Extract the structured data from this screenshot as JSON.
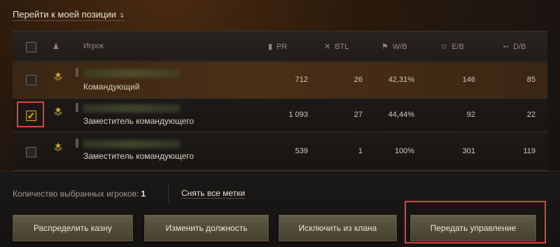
{
  "top": {
    "goto_label": "Перейти к моей позиции",
    "goto_arrow": "↴"
  },
  "table": {
    "headers": {
      "player": "Игрок",
      "pr": "PR",
      "btl": "BTL",
      "wb": "W/B",
      "eb": "E/B",
      "db": "D/B"
    },
    "rows": [
      {
        "role": "Командующий",
        "pr": "712",
        "btl": "26",
        "wb": "42,31%",
        "eb": "146",
        "db": "85",
        "checked": false
      },
      {
        "role": "Заместитель командующего",
        "pr": "1 093",
        "btl": "27",
        "wb": "44,44%",
        "eb": "92",
        "db": "22",
        "checked": true
      },
      {
        "role": "Заместитель командующего",
        "pr": "539",
        "btl": "1",
        "wb": "100%",
        "eb": "301",
        "db": "119",
        "checked": false
      }
    ]
  },
  "footer": {
    "count_label": "Количество выбранных игроков:",
    "count_value": "1",
    "clear_label": "Снять все метки",
    "buttons": {
      "distribute": "Распределить казну",
      "change_role": "Изменить должность",
      "exclude": "Исключить из клана",
      "transfer": "Передать управление"
    }
  },
  "colors": {
    "highlight": "#d9453c",
    "checkbox_accent": "#e5b73b",
    "rank_gold": "#d6a93a"
  },
  "icons": [
    "role-icon",
    "pr-icon",
    "battles-icon",
    "wins-icon",
    "experience-icon",
    "damage-icon",
    "rank-chevron-icon",
    "check-icon"
  ]
}
